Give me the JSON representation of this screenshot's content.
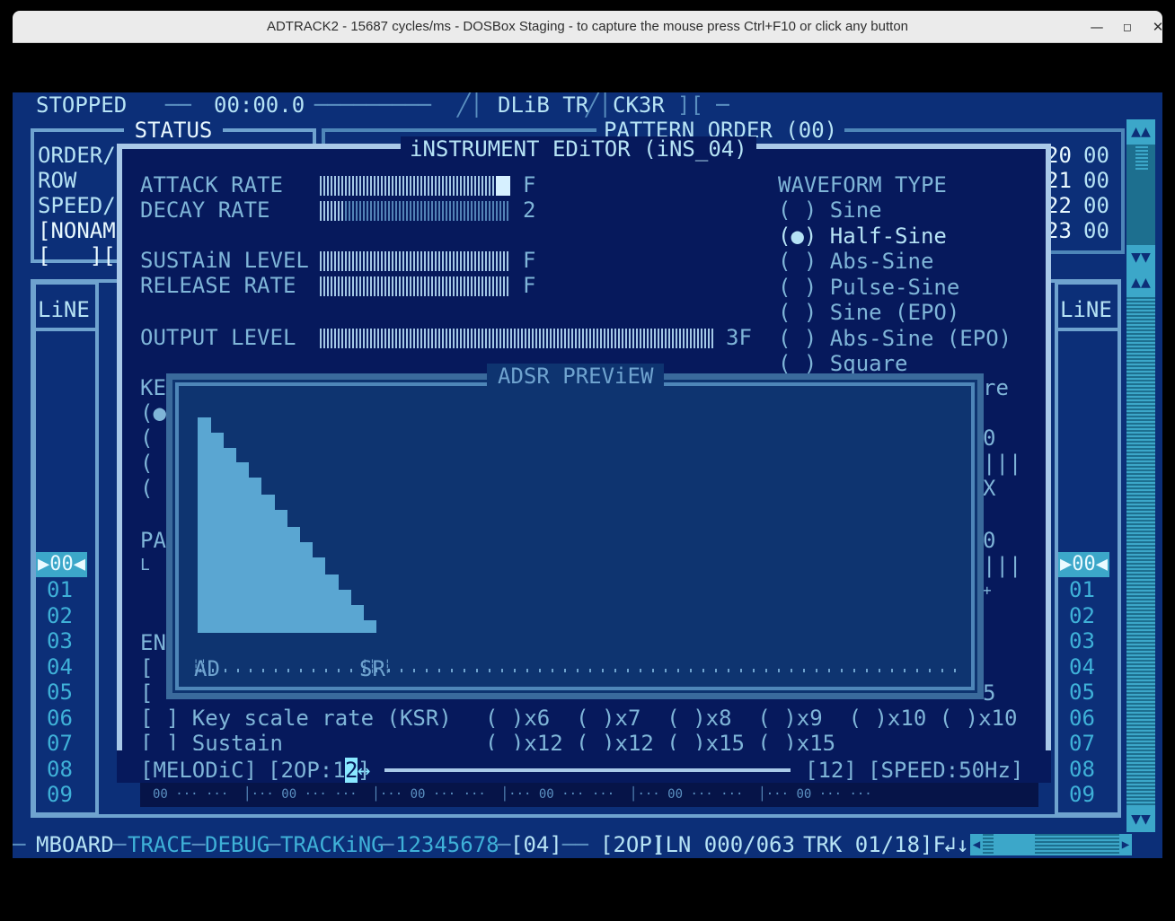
{
  "window": {
    "title": "ADTRACK2 - 15687 cycles/ms - DOSBox Staging - to capture the mouse press Ctrl+F10 or click any button",
    "minimize_icon": "minimize-icon",
    "maximize_icon": "maximize-icon",
    "close_icon": "close-icon"
  },
  "topbar": {
    "state": "STOPPED",
    "time": "00:00.0",
    "logo": "DLiB TR",
    "logo2": "CK3R"
  },
  "status": {
    "title": "STATUS",
    "order_label": "ORDER/",
    "row_label": "ROW",
    "speed_label": "SPEED/",
    "song_name": "[NONAM",
    "song_field": "[   ]["
  },
  "pattern_order": {
    "title": "PATTERN ORDER (00)",
    "rows": [
      {
        "idx": "20",
        "val": "00"
      },
      {
        "idx": "21",
        "val": "00"
      },
      {
        "idx": "22",
        "val": "00"
      },
      {
        "idx": "23",
        "val": "00"
      }
    ]
  },
  "pattern": {
    "line_header_left": "LiNE",
    "line_header_right": "LiNE",
    "current_line": "00",
    "lines": [
      "01",
      "02",
      "03",
      "04",
      "05",
      "06",
      "07",
      "08",
      "09"
    ]
  },
  "instrument_editor": {
    "title": "iNSTRUMENT EDiTOR (iNS_04)",
    "params": [
      {
        "label": "ATTACK RATE",
        "value": "F",
        "level": 0.94
      },
      {
        "label": "DECAY RATE",
        "value": "2",
        "level": 0.13
      },
      {
        "label": "SUSTAiN LEVEL",
        "value": "F",
        "level": 1.0
      },
      {
        "label": "RELEASE RATE",
        "value": "F",
        "level": 1.0
      },
      {
        "label": "OUTPUT LEVEL",
        "value": "3F",
        "level": 1.0
      }
    ],
    "waveform": {
      "title": "WAVEFORM TYPE",
      "options": [
        {
          "label": "Sine",
          "selected": false
        },
        {
          "label": "Half-Sine",
          "selected": true
        },
        {
          "label": "Abs-Sine",
          "selected": false
        },
        {
          "label": "Pulse-Sine",
          "selected": false
        },
        {
          "label": "Sine (EPO)",
          "selected": false
        },
        {
          "label": "Abs-Sine (EPO)",
          "selected": false
        },
        {
          "label": "Square",
          "selected": false
        }
      ]
    },
    "partial_left": {
      "ke": "KE",
      "pa": "PA",
      "en": "EN",
      "l": "L"
    },
    "partial_right": {
      "re": "re",
      "v0a": "0",
      "x": "X",
      "v0b": "0",
      "plus": "+",
      "v5": "5"
    },
    "ksr_label": "[ ] Key scale rate (KSR)",
    "sustain_label": "[ ] Sustain",
    "mult_row1": "( )x6  ( )x7  ( )x8  ( )x9  ( )x10 ( )x10",
    "mult_row2": "( )x12 ( )x12 ( )x15 ( )x15",
    "footer_left": "[MELODiC]",
    "footer_op": "[2OP:1",
    "footer_op_sel": "2",
    "footer_op_end": "]",
    "footer_num": "[12]",
    "footer_speed": "[SPEED:50Hz]"
  },
  "adsr_preview": {
    "title": "ADSR PREViEW",
    "marker_ad": "AD",
    "marker_sr": "SR",
    "envelope_levels": [
      1.0,
      0.93,
      0.86,
      0.79,
      0.72,
      0.64,
      0.57,
      0.49,
      0.42,
      0.35,
      0.27,
      0.2,
      0.13,
      0.06
    ]
  },
  "bottom": {
    "mboard": "MBOARD",
    "trace": "TRACE",
    "debug": "DEBUG",
    "tracking": "TRACKiNG",
    "channels": "12345678",
    "ch_num": "[04]",
    "op": "[2OP]",
    "ln": "[LN 000/063",
    "trk": "TRK 01/18]F",
    "arrows": "↲↓"
  }
}
